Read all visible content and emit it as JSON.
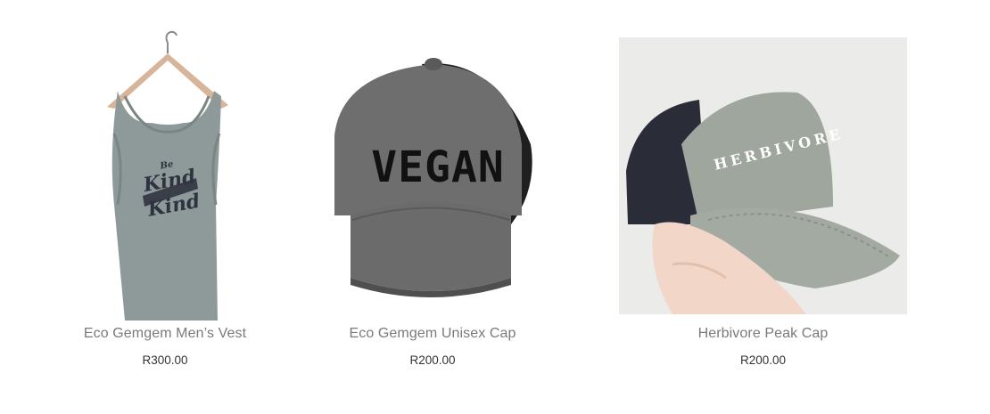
{
  "products": [
    {
      "title": "Eco Gemgem Men’s Vest",
      "price": "R300.00",
      "image": "grey-tank-top-on-hanger",
      "graphic_text": [
        "Be",
        "Kind",
        "Kind"
      ]
    },
    {
      "title": "Eco Gemgem Unisex Cap",
      "price": "R200.00",
      "image": "grey-trucker-cap",
      "graphic_text": [
        "VEGAN"
      ]
    },
    {
      "title": "Herbivore Peak Cap",
      "price": "R200.00",
      "image": "khaki-trucker-cap-in-hand",
      "graphic_text": [
        "HERBIVORE"
      ]
    }
  ],
  "colors": {
    "title": "#7a7a7a",
    "price": "#333333",
    "vest": "#8e9a99",
    "cap_grey": "#6e6e6e",
    "mesh": "#1f1f1f",
    "khaki": "#9fa69d"
  }
}
